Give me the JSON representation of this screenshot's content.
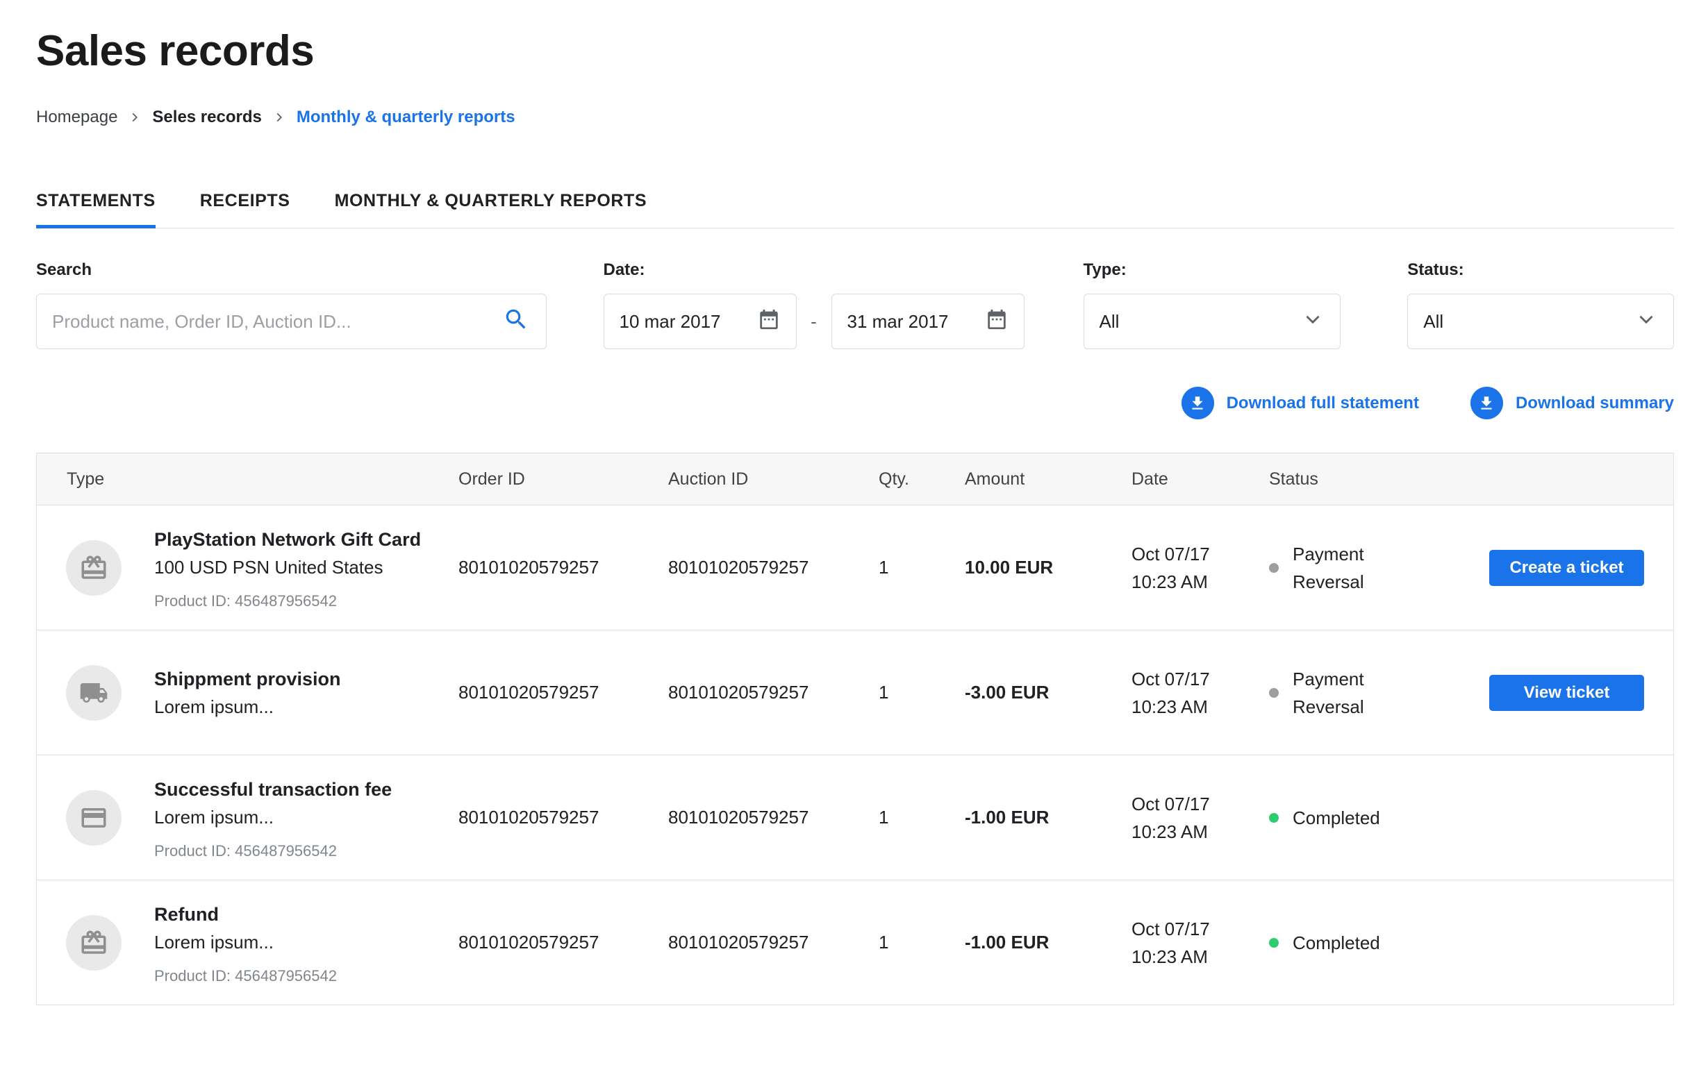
{
  "page": {
    "title": "Sales records"
  },
  "breadcrumb": {
    "items": [
      {
        "label": "Homepage"
      },
      {
        "label": "Seles records"
      },
      {
        "label": "Monthly & quarterly reports"
      }
    ]
  },
  "tabs": [
    {
      "label": "STATEMENTS",
      "active": true
    },
    {
      "label": "RECEIPTS",
      "active": false
    },
    {
      "label": "MONTHLY & QUARTERLY REPORTS",
      "active": false
    }
  ],
  "filters": {
    "search": {
      "label": "Search",
      "placeholder": "Product name, Order ID, Auction ID..."
    },
    "date": {
      "label": "Date:",
      "from": "10 mar 2017",
      "to": "31 mar 2017",
      "separator": "-"
    },
    "type": {
      "label": "Type:",
      "value": "All"
    },
    "status": {
      "label": "Status:",
      "value": "All"
    }
  },
  "downloads": {
    "full_statement": "Download full statement",
    "summary": "Download summary"
  },
  "table": {
    "headers": [
      "Type",
      "Order ID",
      "Auction ID",
      "Qty.",
      "Amount",
      "Date",
      "Status",
      ""
    ],
    "rows": [
      {
        "icon": "gift-icon",
        "name": "PlayStation Network Gift Card",
        "subtitle": "100 USD PSN United States",
        "product_id": "Product ID: 456487956542",
        "order_id": "80101020579257",
        "auction_id": "80101020579257",
        "qty": "1",
        "amount": "10.00 EUR",
        "date_line1": "Oct 07/17",
        "date_line2": "10:23 AM",
        "status": "Payment Reversal",
        "status_color": "#9e9e9e",
        "action": "Create a ticket"
      },
      {
        "icon": "truck-icon",
        "name": "Shippment provision",
        "subtitle": "Lorem ipsum...",
        "product_id": "",
        "order_id": "80101020579257",
        "auction_id": "80101020579257",
        "qty": "1",
        "amount": "-3.00 EUR",
        "date_line1": "Oct 07/17",
        "date_line2": "10:23 AM",
        "status": "Payment Reversal",
        "status_color": "#9e9e9e",
        "action": "View ticket"
      },
      {
        "icon": "credit-card-icon",
        "name": "Successful transaction fee",
        "subtitle": "Lorem ipsum...",
        "product_id": "Product ID: 456487956542",
        "order_id": "80101020579257",
        "auction_id": "80101020579257",
        "qty": "1",
        "amount": "-1.00 EUR",
        "date_line1": "Oct 07/17",
        "date_line2": "10:23 AM",
        "status": "Completed",
        "status_color": "#2ecc71",
        "action": null
      },
      {
        "icon": "gift-icon",
        "name": "Refund",
        "subtitle": "Lorem ipsum...",
        "product_id": "Product ID: 456487956542",
        "order_id": "80101020579257",
        "auction_id": "80101020579257",
        "qty": "1",
        "amount": "-1.00 EUR",
        "date_line1": "Oct 07/17",
        "date_line2": "10:23 AM",
        "status": "Completed",
        "status_color": "#2ecc71",
        "action": null
      }
    ]
  },
  "icons": {
    "search": "search-icon",
    "calendar": "calendar-icon",
    "chevron_down": "chevron-down-icon",
    "download": "download-icon",
    "breadcrumb_separator": "chevron-right-icon"
  },
  "colors": {
    "accent_blue": "#1a73e8",
    "status_gray": "#9e9e9e",
    "status_green": "#2ecc71",
    "border": "#e0e0e0"
  }
}
